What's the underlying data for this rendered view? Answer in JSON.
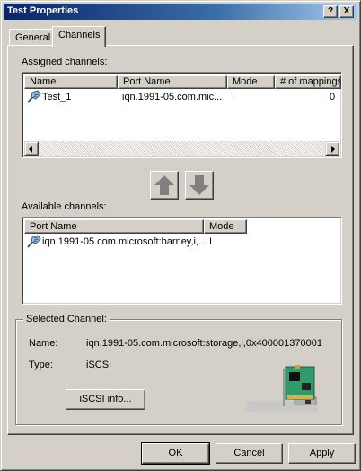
{
  "window": {
    "title": "Test Properties",
    "help_button": "?",
    "close_button": "X"
  },
  "tabs": [
    {
      "label": "General",
      "active": false
    },
    {
      "label": "Channels",
      "active": true
    }
  ],
  "assigned": {
    "label": "Assigned channels:",
    "columns": [
      "Name",
      "Port Name",
      "Mode",
      "# of mappings"
    ],
    "rows": [
      {
        "name": "Test_1",
        "port_name": "iqn.1991-05.com.mic...",
        "mode": "I",
        "mappings": "0"
      }
    ]
  },
  "move_buttons": {
    "up_icon": "arrow-up-icon",
    "down_icon": "arrow-down-icon"
  },
  "available": {
    "label": "Available channels:",
    "columns": [
      "Port Name",
      "Mode"
    ],
    "rows": [
      {
        "port_name": "iqn.1991-05.com.microsoft:barney,i,...",
        "mode": "I"
      }
    ]
  },
  "selected": {
    "legend": "Selected Channel:",
    "name_label": "Name:",
    "name_value": "iqn.1991-05.com.microsoft:storage,i,0x400001370001",
    "type_label": "Type:",
    "type_value": "iSCSI",
    "info_button": "iSCSI info...",
    "image_icon": "network-card-icon"
  },
  "footer": {
    "ok": "OK",
    "cancel": "Cancel",
    "apply": "Apply"
  },
  "colors": {
    "title_start": "#0a246a",
    "title_end": "#a6caf0",
    "face": "#d4d0c8"
  }
}
